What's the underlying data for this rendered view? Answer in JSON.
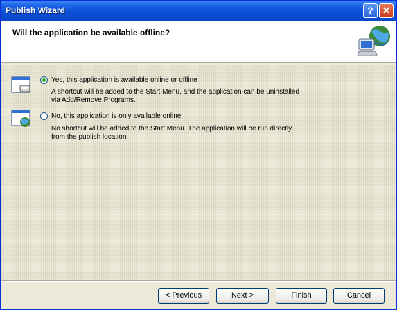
{
  "window": {
    "title": "Publish Wizard"
  },
  "header": {
    "title": "Will the application be available offline?",
    "icon": "globe-computer-icon"
  },
  "options": [
    {
      "label": "Yes, this application is available online or offline",
      "desc_line1": "A shortcut will be added to the Start Menu, and the application can be uninstalled",
      "desc_line2": "via Add/Remove Programs.",
      "selected": true,
      "icon": "offline-app-icon"
    },
    {
      "label": "No, this application is only available online",
      "desc_line1": "No shortcut will be added to the Start Menu. The application will be run directly",
      "desc_line2": "from the publish location.",
      "selected": false,
      "icon": "online-app-icon"
    }
  ],
  "buttons": {
    "previous": "< Previous",
    "next": "Next >",
    "finish": "Finish",
    "cancel": "Cancel"
  },
  "colors": {
    "titlebar": "#0a4fd8",
    "radio_dot": "#21a121",
    "panel": "#ece9d8"
  }
}
